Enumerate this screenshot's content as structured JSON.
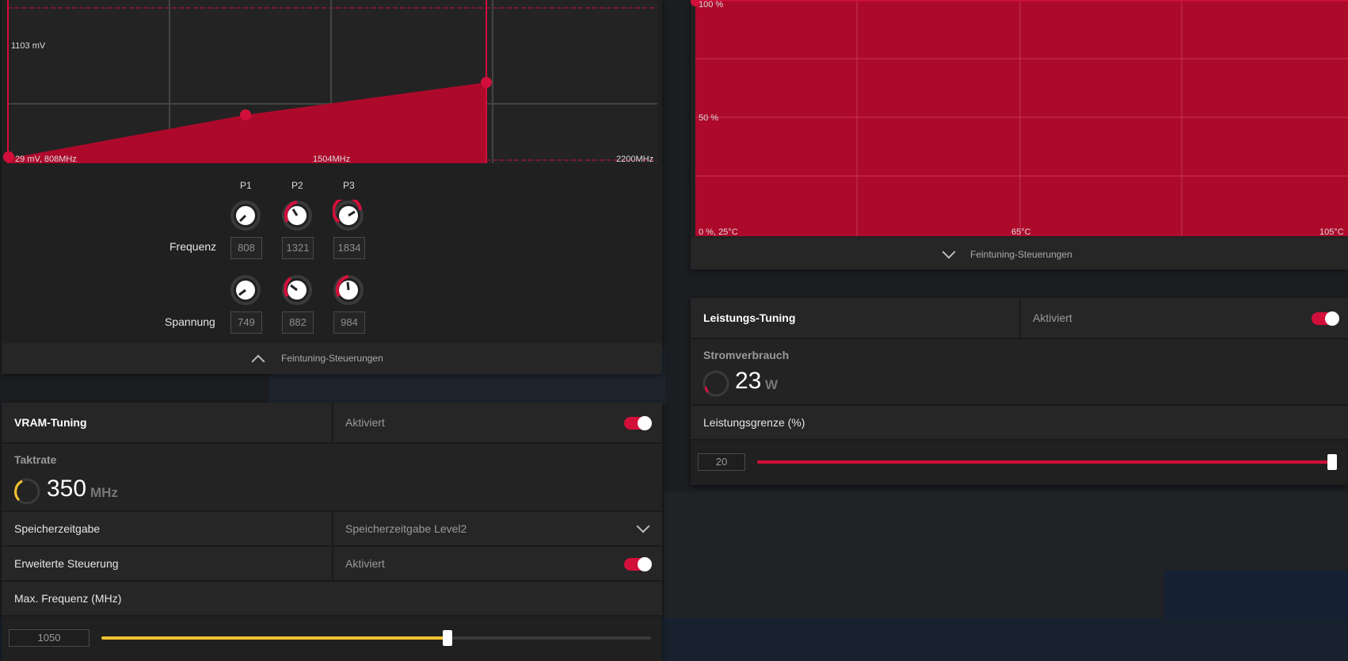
{
  "vf_curve": {
    "voltage_label": "1103 mV",
    "start_label": "29 mV, 808MHz",
    "mid_label": "1504MHz",
    "end_label": "2200MHz",
    "points": [
      "P1",
      "P2",
      "P3"
    ],
    "frequency_label": "Frequenz",
    "voltage_row_label": "Spannung",
    "frequencies": [
      "808",
      "1321",
      "1834"
    ],
    "voltages": [
      "749",
      "882",
      "984"
    ],
    "finetune_label": "Feintuning-Steuerungen"
  },
  "fan_curve": {
    "y_top": "100 %",
    "y_mid": "50 %",
    "x_start": "0 %, 25°C",
    "x_mid": "65°C",
    "x_end": "105°C",
    "finetune_label": "Feintuning-Steuerungen"
  },
  "vram": {
    "title": "VRAM-Tuning",
    "status": "Aktiviert",
    "clock_label": "Taktrate",
    "clock_value": "350",
    "clock_unit": "MHz",
    "timing_label": "Speicherzeitgabe",
    "timing_value": "Speicherzeitgabe Level2",
    "advanced_label": "Erweiterte Steuerung",
    "advanced_status": "Aktiviert",
    "max_freq_label": "Max. Frequenz (MHz)",
    "max_freq_value": "1050",
    "max_freq_fraction": 0.63
  },
  "power": {
    "title": "Leistungs-Tuning",
    "status": "Aktiviert",
    "consumption_label": "Stromverbrauch",
    "consumption_value": "23",
    "consumption_unit": "W",
    "limit_label": "Leistungsgrenze (%)",
    "limit_value": "20",
    "limit_fraction": 1.0
  },
  "colors": {
    "accent": "#d10f3a",
    "yellow": "#f2c12e",
    "chart_fill": "#ad0a2b"
  }
}
